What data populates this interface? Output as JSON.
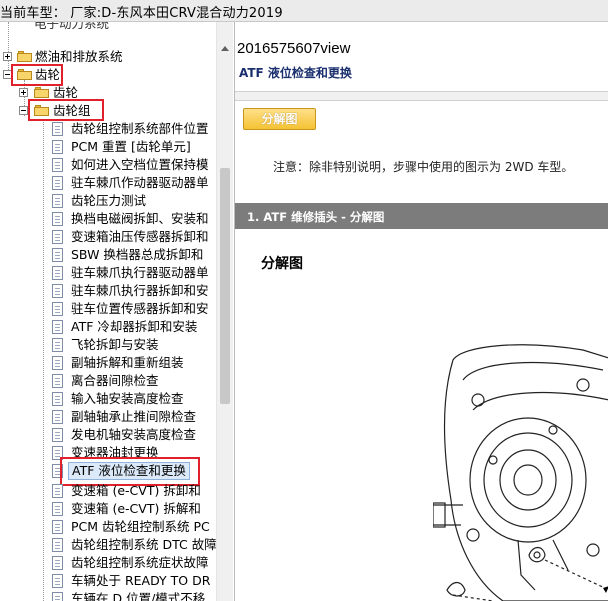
{
  "window": {
    "title": "当前车型：  厂家:D-东风本田CRV混合动力2019"
  },
  "tree": {
    "partial_top_item": "电子动力系统",
    "items": [
      {
        "label": "燃油和排放系统",
        "type": "folder",
        "expander": "plus"
      },
      {
        "label": "齿轮",
        "type": "folder",
        "expander": "minus",
        "highlighted": true
      },
      {
        "label": "齿轮",
        "type": "folder",
        "expander": "plus"
      },
      {
        "label": "齿轮组",
        "type": "folder",
        "expander": "minus",
        "highlighted": true
      },
      {
        "label": "齿轮组控制系统部件位置",
        "type": "doc"
      },
      {
        "label": "PCM 重置 [齿轮单元]",
        "type": "doc"
      },
      {
        "label": "如何进入空档位置保持模",
        "type": "doc"
      },
      {
        "label": "驻车棘爪作动器驱动器单",
        "type": "doc"
      },
      {
        "label": "齿轮压力测试",
        "type": "doc"
      },
      {
        "label": "换档电磁阀拆卸、安装和",
        "type": "doc"
      },
      {
        "label": "变速箱油压传感器拆卸和",
        "type": "doc"
      },
      {
        "label": "SBW 换档器总成拆卸和",
        "type": "doc"
      },
      {
        "label": "驻车棘爪执行器驱动器单",
        "type": "doc"
      },
      {
        "label": "驻车棘爪执行器拆卸和安",
        "type": "doc"
      },
      {
        "label": "驻车位置传感器拆卸和安",
        "type": "doc"
      },
      {
        "label": "ATF 冷却器拆卸和安装",
        "type": "doc"
      },
      {
        "label": "飞轮拆卸与安装",
        "type": "doc"
      },
      {
        "label": "副轴拆解和重新组装",
        "type": "doc"
      },
      {
        "label": "离合器间隙检查",
        "type": "doc"
      },
      {
        "label": "输入轴安装高度检查",
        "type": "doc"
      },
      {
        "label": "副轴轴承止推间隙检查",
        "type": "doc"
      },
      {
        "label": "发电机轴安装高度检查",
        "type": "doc"
      },
      {
        "label": "变速器油封更换",
        "type": "doc"
      },
      {
        "label": "ATF 液位检查和更换",
        "type": "doc",
        "selected": true,
        "highlighted": true
      },
      {
        "label": "变速箱 (e-CVT) 拆卸和",
        "type": "doc"
      },
      {
        "label": "变速箱 (e-CVT) 拆解和",
        "type": "doc"
      },
      {
        "label": "PCM 齿轮组控制系统 PC",
        "type": "doc"
      },
      {
        "label": "齿轮组控制系统 DTC 故障",
        "type": "doc"
      },
      {
        "label": "齿轮组控制系统症状故障",
        "type": "doc"
      },
      {
        "label": "车辆处于 READY TO DR",
        "type": "doc"
      },
      {
        "label": "车辆在 D 位置/模式不移",
        "type": "doc"
      }
    ]
  },
  "content": {
    "doc_id": "2016575607view",
    "title": "ATF 液位检查和更换",
    "exploded_button": "分解图",
    "note": "注意：除非特别说明，步骤中使用的图示为 2WD 车型。",
    "section_title": "1. ATF 维修插头 - 分解图",
    "sub_heading": "分解图"
  },
  "colors": {
    "highlight_box": "#e0212b",
    "section_bar": "#7c7c7c",
    "button": "#f4c233"
  }
}
